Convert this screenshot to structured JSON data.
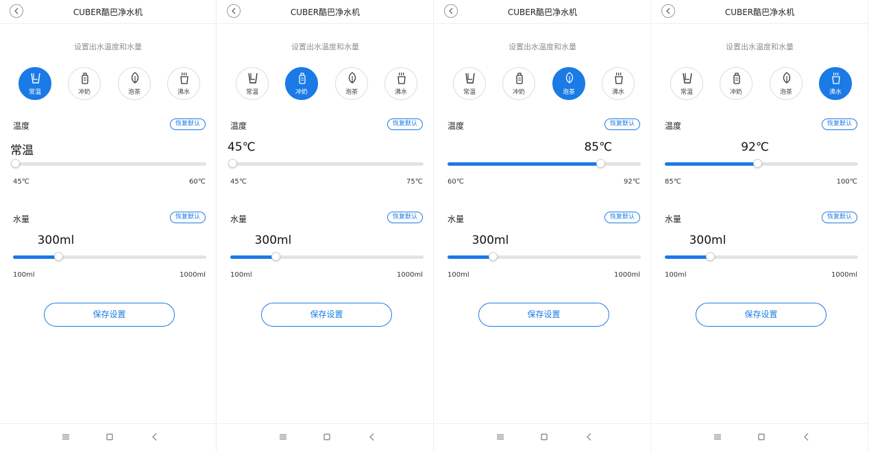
{
  "app_title": "CUBER酷巴净水机",
  "subtitle": "设置出水温度和水量",
  "mode_labels": [
    "常温",
    "冲奶",
    "泡茶",
    "沸水"
  ],
  "temp_label": "温度",
  "volume_label": "水量",
  "reset_label": "恢复默认",
  "save_label": "保存设置",
  "colors": {
    "accent": "#1a7ae6",
    "track": "#e3e3e3"
  },
  "icons": [
    "back-chevron-icon",
    "cup-icon",
    "baby-bottle-icon",
    "tea-leaf-icon",
    "boiling-water-icon",
    "menu-lines-icon",
    "home-square-icon",
    "back-arrow-icon"
  ],
  "screens": [
    {
      "active_mode": 0,
      "temperature": {
        "value": "常温",
        "min": "45℃",
        "max": "60℃",
        "fraction": 0.0
      },
      "volume": {
        "value": "300ml",
        "min": "100ml",
        "max": "1000ml",
        "fraction": 0.222
      }
    },
    {
      "active_mode": 1,
      "temperature": {
        "value": "45℃",
        "min": "45℃",
        "max": "75℃",
        "fraction": 0.0
      },
      "volume": {
        "value": "300ml",
        "min": "100ml",
        "max": "1000ml",
        "fraction": 0.222
      }
    },
    {
      "active_mode": 2,
      "temperature": {
        "value": "85℃",
        "min": "60℃",
        "max": "92℃",
        "fraction": 0.78
      },
      "volume": {
        "value": "300ml",
        "min": "100ml",
        "max": "1000ml",
        "fraction": 0.222
      }
    },
    {
      "active_mode": 3,
      "temperature": {
        "value": "92℃",
        "min": "85℃",
        "max": "100℃",
        "fraction": 0.467
      },
      "volume": {
        "value": "300ml",
        "min": "100ml",
        "max": "1000ml",
        "fraction": 0.222
      }
    }
  ]
}
